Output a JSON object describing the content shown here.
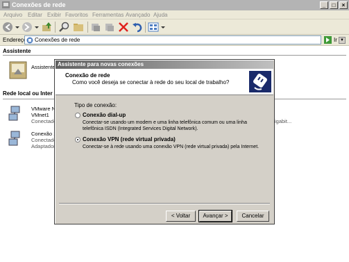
{
  "window": {
    "title": "Conexões de rede"
  },
  "menu": [
    "Arquivo",
    "Editar",
    "Exibir",
    "Favoritos",
    "Ferramentas",
    "Avançado",
    "Ajuda"
  ],
  "address": {
    "label": "Endereço",
    "value": "Conexões de rede",
    "go": "Ir"
  },
  "panel": {
    "wizard_header": "Assistente",
    "wizard_item": "Assistente",
    "lan_header": "Rede local ou Inter",
    "items": [
      {
        "name": "VMware Ne",
        "line2": "VMnet1",
        "status": "Conectado"
      },
      {
        "name": "Conexão 1",
        "line2": "Conectado",
        "status": "Adaptador"
      }
    ],
    "extra": "igabit..."
  },
  "dialog": {
    "title": "Assistente para novas conexões",
    "header_title": "Conexão de rede",
    "header_sub": "Como você deseja se conectar à rede do seu local de trabalho?",
    "type_label": "Tipo de conexão:",
    "options": [
      {
        "title": "Conexão dial-up",
        "desc1": "Conectar-se usando um modem e uma linha telefônica comum ou uma linha",
        "desc2": "telefônica ISDN (Integrated Services Digital Network).",
        "checked": false
      },
      {
        "title": "Conexão VPN (rede virtual privada)",
        "desc1": "Conectar-se à rede usando uma conexão VPN (rede virtual privada) pela Internet.",
        "desc2": "",
        "checked": true
      }
    ],
    "buttons": {
      "back": "< Voltar",
      "next": "Avançar >",
      "cancel": "Cancelar"
    }
  }
}
